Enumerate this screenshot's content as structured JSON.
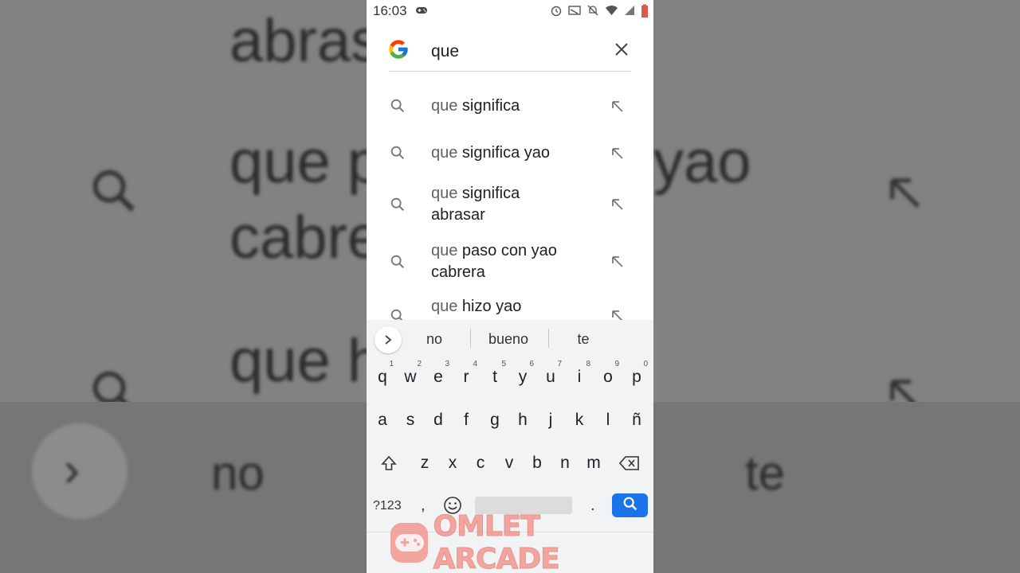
{
  "status_bar": {
    "time": "16:03",
    "icons": [
      "gamepad-icon",
      "alarm-icon",
      "cast-icon",
      "mute-icon",
      "wifi-icon",
      "signal-icon",
      "battery-icon"
    ]
  },
  "search": {
    "query": "que",
    "logo": "google-g-logo",
    "clear_icon": "close-icon"
  },
  "suggestions": [
    {
      "prefix": "que",
      "rest": " significa",
      "line2": ""
    },
    {
      "prefix": "que",
      "rest": " significa yao",
      "line2": ""
    },
    {
      "prefix": "que",
      "rest": " significa",
      "line2": "abrasar"
    },
    {
      "prefix": "que",
      "rest": " paso con yao",
      "line2": "cabrera"
    },
    {
      "prefix": "que",
      "rest": " hizo yao",
      "line2": ""
    }
  ],
  "keyboard": {
    "predictions": [
      "no",
      "bueno",
      "te"
    ],
    "row1": [
      {
        "k": "q",
        "n": "1"
      },
      {
        "k": "w",
        "n": "2"
      },
      {
        "k": "e",
        "n": "3"
      },
      {
        "k": "r",
        "n": "4"
      },
      {
        "k": "t",
        "n": "5"
      },
      {
        "k": "y",
        "n": "6"
      },
      {
        "k": "u",
        "n": "7"
      },
      {
        "k": "i",
        "n": "8"
      },
      {
        "k": "o",
        "n": "9"
      },
      {
        "k": "p",
        "n": "0"
      }
    ],
    "row2": [
      "a",
      "s",
      "d",
      "f",
      "g",
      "h",
      "j",
      "k",
      "l",
      "ñ"
    ],
    "row3": [
      "z",
      "x",
      "c",
      "v",
      "b",
      "n",
      "m"
    ],
    "symbols_label": "?123",
    "comma": ",",
    "period": "."
  },
  "watermark": {
    "text": "OMLET ARCADE"
  },
  "colors": {
    "accent": "#1a73e8",
    "watermark": "#f28b82"
  }
}
